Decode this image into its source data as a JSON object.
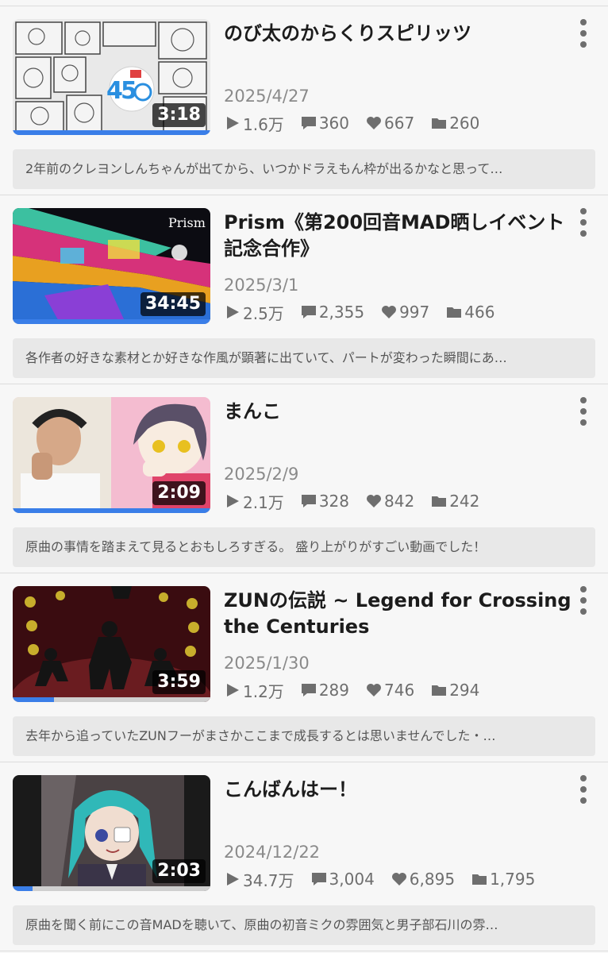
{
  "accent_color": "#3a7ee8",
  "icons": {
    "views": "play-icon",
    "comments": "comment-icon",
    "likes": "heart-icon",
    "mylists": "folder-icon",
    "menu": "kebab-menu-icon"
  },
  "videos": [
    {
      "title": "のび太のからくりスピリッツ",
      "duration": "3:18",
      "date": "2025/4/27",
      "views": "1.6万",
      "comments": "360",
      "likes": "667",
      "mylists": "260",
      "watch_progress": 1.0,
      "comment_text": "2年前のクレヨンしんちゃんが出てから、いつかドラえもん枠が出るかなと思って…"
    },
    {
      "title": "Prism《第200回音MAD晒しイベント記念合作》",
      "duration": "34:45",
      "date": "2025/3/1",
      "views": "2.5万",
      "comments": "2,355",
      "likes": "997",
      "mylists": "466",
      "watch_progress": 1.0,
      "comment_text": "各作者の好きな素材とか好きな作風が顕著に出ていて、パートが変わった瞬間にあ…"
    },
    {
      "title": "まんこ",
      "duration": "2:09",
      "date": "2025/2/9",
      "views": "2.1万",
      "comments": "328",
      "likes": "842",
      "mylists": "242",
      "watch_progress": 1.0,
      "comment_text": "原曲の事情を踏まえて見るとおもしろすぎる。 盛り上がりがすごい動画でした！"
    },
    {
      "title": "ZUNの伝説 ~ Legend for Crossing the Centuries",
      "duration": "3:59",
      "date": "2025/1/30",
      "views": "1.2万",
      "comments": "289",
      "likes": "746",
      "mylists": "294",
      "watch_progress": 0.21,
      "comment_text": "去年から追っていたZUNフーがまさかここまで成長するとは思いませんでした・…"
    },
    {
      "title": "こんばんはー！",
      "duration": "2:03",
      "date": "2024/12/22",
      "views": "34.7万",
      "comments": "3,004",
      "likes": "6,895",
      "mylists": "1,795",
      "watch_progress": 0.1,
      "comment_text": "原曲を聞く前にこの音MADを聴いて、原曲の初音ミクの雰囲気と男子部石川の雰…"
    }
  ]
}
